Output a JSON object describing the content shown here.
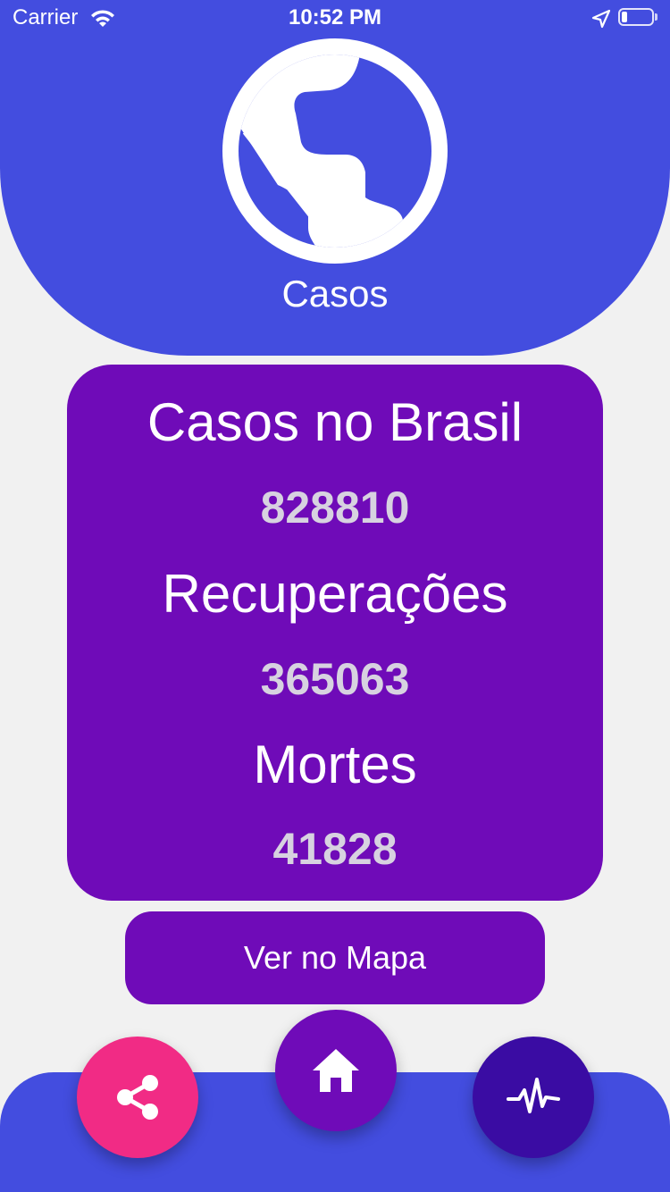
{
  "status_bar": {
    "carrier": "Carrier",
    "time": "10:52 PM",
    "wifi_icon": "wifi-icon",
    "location_icon": "location-arrow-icon",
    "battery_icon": "battery-icon",
    "battery_level": 0.2
  },
  "header": {
    "icon": "globe-icon",
    "title": "Casos"
  },
  "stats": {
    "cases_label": "Casos no Brasil",
    "cases_value": "828810",
    "recovered_label": "Recuperações",
    "recovered_value": "365063",
    "deaths_label": "Mortes",
    "deaths_value": "41828"
  },
  "map_button": {
    "label": "Ver no Mapa"
  },
  "bottom_nav": {
    "share_icon": "share-icon",
    "home_icon": "home-icon",
    "activity_icon": "activity-pulse-icon"
  },
  "colors": {
    "primary_blue": "#434DDF",
    "purple": "#6F0BB8",
    "pink": "#F12B85",
    "deep_indigo": "#3A0CA3",
    "background": "#F1F1F1",
    "value_text": "#D7D2E0"
  }
}
